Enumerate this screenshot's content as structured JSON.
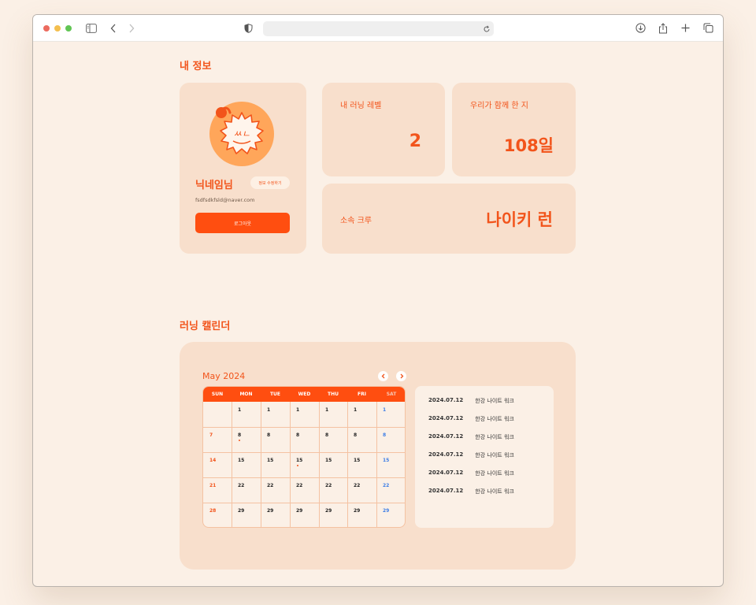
{
  "browser": {
    "url": ""
  },
  "profile": {
    "section_title": "내 정보",
    "nickname": "닉네임님",
    "edit_label": "정보 수정하기",
    "email": "fsdfsdkfsld@naver.com",
    "logout_label": "로그아웃"
  },
  "stats": {
    "level_label": "내 러닝 레벨",
    "level_value": "2",
    "days_label": "우리가 함께 한 지",
    "days_value": "108일",
    "crew_label": "소속 크루",
    "crew_value": "나이키 런"
  },
  "calendar": {
    "section_title": "러닝 캘린더",
    "month_label": "May 2024",
    "weekdays": [
      "SUN",
      "MON",
      "TUE",
      "WED",
      "THU",
      "FRI",
      "SAT"
    ],
    "rows": [
      [
        "",
        "1",
        "1",
        "1",
        "1",
        "1",
        "1"
      ],
      [
        "7",
        "8",
        "8",
        "8",
        "8",
        "8",
        "8"
      ],
      [
        "14",
        "15",
        "15",
        "15",
        "15",
        "15",
        "15"
      ],
      [
        "21",
        "22",
        "22",
        "22",
        "22",
        "22",
        "22"
      ],
      [
        "28",
        "29",
        "29",
        "29",
        "29",
        "29",
        "29"
      ]
    ],
    "colors": {
      "sunday": "#f2541b",
      "saturday": "#3d7ee6",
      "accent": "#ff4e10"
    }
  },
  "runs": [
    {
      "date": "2024.07.12",
      "title": "한강 나이트 워크"
    },
    {
      "date": "2024.07.12",
      "title": "한강 나이트 워크"
    },
    {
      "date": "2024.07.12",
      "title": "한강 나이트 워크"
    },
    {
      "date": "2024.07.12",
      "title": "한강 나이트 워크"
    },
    {
      "date": "2024.07.12",
      "title": "한강 나이트 워크"
    },
    {
      "date": "2024.07.12",
      "title": "한강 나이트 워크"
    }
  ]
}
